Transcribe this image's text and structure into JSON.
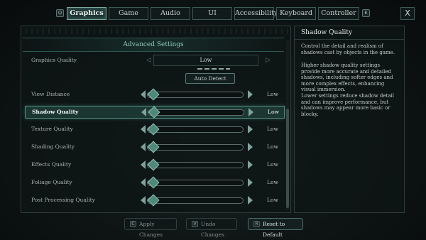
{
  "tabs": {
    "prev_key": "Q",
    "next_key": "E",
    "items": [
      {
        "label": "Graphics",
        "active": true
      },
      {
        "label": "Game"
      },
      {
        "label": "Audio"
      },
      {
        "label": "UI"
      },
      {
        "label": "Accessibility"
      },
      {
        "label": "Keyboard"
      },
      {
        "label": "Controller"
      }
    ],
    "close_label": "X"
  },
  "settings": {
    "section_title": "Advanced Settings",
    "graphics_quality": {
      "label": "Graphics Quality",
      "value": "Low",
      "left_arrow": "◁",
      "right_arrow": "▷"
    },
    "auto_detect_label": "Auto Detect",
    "rows": [
      {
        "label": "View Distance",
        "value": "Low",
        "level": 0
      },
      {
        "label": "Shadow Quality",
        "value": "Low",
        "level": 0,
        "selected": true
      },
      {
        "label": "Texture Quality",
        "value": "Low",
        "level": 0
      },
      {
        "label": "Shading Quality",
        "value": "Low",
        "level": 0
      },
      {
        "label": "Effects Quality",
        "value": "Low",
        "level": 0
      },
      {
        "label": "Foliage Quality",
        "value": "Low",
        "level": 0
      },
      {
        "label": "Post Processing Quality",
        "value": "Low",
        "level": 0
      }
    ]
  },
  "description": {
    "title": "Shadow Quality",
    "paragraphs": [
      "Control the detail and realism of shadows cast by objects in the game.",
      "Higher shadow quality settings provide more accurate and detailed shadows, including softer edges and more complex effects, enhancing visual immersion.",
      "Lower settings reduce shadow detail and can improve performance, but shadows may appear more basic or blocky."
    ]
  },
  "footer": {
    "apply": {
      "key": "C",
      "label": "Apply Changes"
    },
    "undo": {
      "key": "V",
      "label": "Undo Changes"
    },
    "reset": {
      "key": "R",
      "label": "Reset to Default"
    }
  },
  "colors": {
    "accent": "#4f8e80",
    "background": "#0b0f0f"
  }
}
